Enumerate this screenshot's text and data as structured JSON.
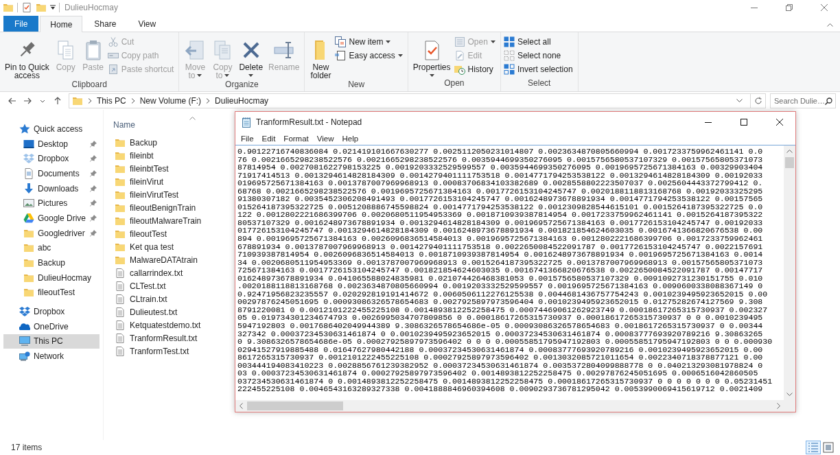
{
  "explorer_window": {
    "title": "DulieuHocmay"
  },
  "tabs": [
    {
      "label": "File",
      "kind": "file",
      "selected": false
    },
    {
      "label": "Home",
      "kind": "tab",
      "selected": true
    },
    {
      "label": "Share",
      "kind": "tab",
      "selected": false
    },
    {
      "label": "View",
      "kind": "tab",
      "selected": false
    }
  ],
  "ribbon": [
    {
      "label": "Clipboard",
      "large": [
        {
          "label": "Pin to Quick\naccess",
          "disabled": false
        },
        {
          "label": "Copy",
          "disabled": true
        },
        {
          "label": "Paste",
          "disabled": true
        }
      ],
      "small": [
        {
          "label": "Cut",
          "disabled": true
        },
        {
          "label": "Copy path",
          "disabled": true
        },
        {
          "label": "Paste shortcut",
          "disabled": true
        }
      ]
    },
    {
      "label": "Organize",
      "large": [
        {
          "label": "Move\nto",
          "disabled": true,
          "dropdown": true
        },
        {
          "label": "Copy\nto",
          "disabled": true,
          "dropdown": true
        },
        {
          "label": "Delete",
          "disabled": false,
          "menu_below": true
        },
        {
          "label": "Rename",
          "disabled": true
        }
      ]
    },
    {
      "label": "New",
      "large": [
        {
          "label": "New\nfolder",
          "disabled": false
        }
      ],
      "small": [
        {
          "label": "New item",
          "disabled": false,
          "dropdown": true
        },
        {
          "label": "Easy access",
          "disabled": false,
          "dropdown": true
        }
      ]
    },
    {
      "label": "Open",
      "large": [
        {
          "label": "Properties",
          "disabled": false,
          "menu_below": true
        }
      ],
      "small": [
        {
          "label": "Open",
          "disabled": true,
          "dropdown": true
        },
        {
          "label": "Edit",
          "disabled": true
        },
        {
          "label": "History",
          "disabled": false
        }
      ]
    },
    {
      "label": "Select",
      "small": [
        {
          "label": "Select all",
          "disabled": false
        },
        {
          "label": "Select none",
          "disabled": false
        },
        {
          "label": "Invert selection",
          "disabled": false
        }
      ]
    }
  ],
  "address_bar": {
    "breadcrumbs": [
      "This PC",
      "New Volume (F:)",
      "DulieuHocmay"
    ]
  },
  "search": {
    "placeholder": "Search Dulie…"
  },
  "navigation_pane": {
    "items": [
      {
        "label": "Quick access",
        "kind": "place",
        "selected": false,
        "children": [
          {
            "label": "Desktop",
            "kind": "place",
            "pinned": true,
            "selected": false
          },
          {
            "label": "Dropbox",
            "kind": "place",
            "pinned": true,
            "selected": false
          },
          {
            "label": "Documents",
            "kind": "place",
            "pinned": true,
            "selected": false
          },
          {
            "label": "Downloads",
            "kind": "place",
            "pinned": true,
            "selected": false
          },
          {
            "label": "Pictures",
            "kind": "place",
            "pinned": true,
            "selected": false
          },
          {
            "label": "Google Drive",
            "kind": "place",
            "pinned": true,
            "selected": false
          },
          {
            "label": "Googledriver",
            "kind": "folder",
            "pinned": true,
            "selected": false
          },
          {
            "label": "abc",
            "kind": "folder",
            "pinned": false,
            "selected": false
          },
          {
            "label": "Backup",
            "kind": "folder",
            "pinned": false,
            "selected": false
          },
          {
            "label": "DulieuHocmay",
            "kind": "folder",
            "pinned": false,
            "selected": false
          },
          {
            "label": "fileoutTest",
            "kind": "folder",
            "pinned": false,
            "selected": false
          }
        ]
      },
      {
        "label": "Dropbox",
        "kind": "place",
        "selected": false
      },
      {
        "label": "OneDrive",
        "kind": "place",
        "selected": false
      },
      {
        "label": "This PC",
        "kind": "place",
        "selected": true
      },
      {
        "label": "Network",
        "kind": "place",
        "selected": false
      }
    ]
  },
  "file_list": {
    "column_header": "Name",
    "items": [
      {
        "name": "Backup",
        "kind": "folder"
      },
      {
        "name": "fileinbt",
        "kind": "folder"
      },
      {
        "name": "fileinbtTest",
        "kind": "folder"
      },
      {
        "name": "fileinVirut",
        "kind": "folder"
      },
      {
        "name": "fileinVirutTest",
        "kind": "folder"
      },
      {
        "name": "fileoutBenignTrain",
        "kind": "folder"
      },
      {
        "name": "fileoutMalwareTrain",
        "kind": "folder"
      },
      {
        "name": "fileoutTest",
        "kind": "folder"
      },
      {
        "name": "Ket qua test",
        "kind": "folder"
      },
      {
        "name": "MalwareDATAtrain",
        "kind": "folder"
      },
      {
        "name": "callarrindex.txt",
        "kind": "text"
      },
      {
        "name": "CLTest.txt",
        "kind": "text"
      },
      {
        "name": "CLtrain.txt",
        "kind": "text"
      },
      {
        "name": "Dulieutest.txt",
        "kind": "text"
      },
      {
        "name": "Ketquatestdemo.txt",
        "kind": "text"
      },
      {
        "name": "TranformResult.txt",
        "kind": "text"
      },
      {
        "name": "TranformTest.txt",
        "kind": "text"
      }
    ]
  },
  "status_bar": {
    "item_count": "17 items",
    "view_buttons": [
      {
        "selected": true
      },
      {
        "selected": false
      }
    ]
  },
  "notepad": {
    "title": "TranformResult.txt - Notepad",
    "menu": [
      "File",
      "Edit",
      "Format",
      "View",
      "Help"
    ],
    "lines": [
      "0.90122716740836084 0.021419101667630277 0.0025112050231014807 0.0023634870805660994 0.0017233759962461141 0.0",
      "76 0.0021665298238522576 0.0021665298238522576 0.0035944699350276095 0.0015756580537107329 0.00157565805371073",
      "87814954 0.0027081622798153225 0.0019203332529599557 0.0035944699350276095 0.0019695725671384163 0.00329903404",
      "71917414513 0.0013294614828184309 0.0014279401111753518 0.0014771794253538122 0.0013294614828184309 0.00192033",
      "019695725671384163 0.0013787007969968913 0.00083706834103382689 0.0028558802223507037 0.0025604443372799412 0.",
      "68768 0.0021665298238522576 0.0019695725671384163 0.0017726153104245747 0.0020188118813168768 0.00192033325295",
      "91380307182 0.0035452306208491493 0.0017726153104245747 0.0016248973678891934 0.0014771794253538122 0.00157565",
      "015264187395322725 0.0051208886745598824 0.0014771794253538122 0.0012309828544615101 0.0015264187395322725 0.0",
      "122 0.0012802221686399706 0.0020680511954953369 0.0018710939387814954 0.0017233759962461141 0.0015264187395322",
      "80537107329 0.0016248973678891934 0.0013294614828184309 0.0019695725671384163 0.0017726153104245747 0.00192033",
      "017726153104245747 0.0013294614828184309 0.0016248973678891934 0.001821854624603035 0.0016741366820676538 0.00",
      "894 0.0019695725671384163 0.0026096836514584013 0.0019695725671384163 0.0012802221686399706 0.0017233759962461",
      "678891934 0.0013787007969968913 0.0014279401111753518 0.0022650084522091787 0.0017726153104245747 0.0022157691",
      "710939387814954 0.0026096836514584013 0.0018710939387814954 0.0016248973678891934 0.0019695725671384163 0.0014",
      "34 0.0020680511954953369 0.0013787007969968913 0.0015264187395322725 0.0013787007969968913 0.00157565805371073",
      "725671384163 0.0017726153104245747 0.001821854624603035 0.0016741366820676538 0.0022650084522091787 0.00147717",
      "016248973678891934 0.041065588024835981 0.021074426468381053 0.0015756580537107329 0.0091092731230151755 0.010",
      ".0020188118813168768 0.0023634870805660994 0.0019203332529599557 0.0019695725671384163 0.0090600338088367149 0",
      "0.92471956823235557 0.020292819191414672 0.0060506112276125538 0.0044681436757754243 0.0010239495923652015 0.00",
      "00297876245051695 0.00093086326578654683 0.0027925897973596404 0.0010239495923652015 0.01275282674127569 9.308",
      "8791220081 0 0.0012101222455225108 0.0014893812252258475 0.00074469061262923749 0.00018617265315730937 0.002327",
      "05 0.019734301234674793 0.0026995034707809856 0 0.00018617265315730937 0.00018617265315730937 0 0 0.0010239495",
      "5947192803 0.0017686402049944389 9.3086326578654686e-05 0.00093086326578654683 0.0018617265315730937 0 0.00344",
      "327342 0.00037234530631461874 0 0.0010239495923652015 0.00037234530631461874 0.00083777693920789216 9.30863265",
      "0 9.3086326578654686e-05 0.00027925897973596402 0 0 0 0.00055851795947192803 0.00055851795947192803 0 0 0.000930",
      "02941527919885488 0.01647627980442188 0.00037234530631461874 0.00083777693920789216 0.0010239495923652015 0.00",
      "8617265315730937 0.0012101222455225108 0.00027925897973596402 0.0013032085721011654 0.0022340718378877121 0.00",
      "003444194083410223 0.0028856761239382952 0.00037234530631461874 0.0035372804099888778 0 0.040213293081978824 0",
      "03 0.00037234530631461874 0.00027925897973596402 0.0014893812252258475 0.00297876245051695 0.0006516042860505",
      "037234530631461874 0 0.0014893812252258475 0.0014893812252258475 0.00018617265315730937 0 0 0 0 0 0 0 0.05231451",
      "222455225108 0.0046543163289327338 0.0041888846960394608 0.0090293736781295042 0.0053990069415619712 0.0021409"
    ]
  }
}
